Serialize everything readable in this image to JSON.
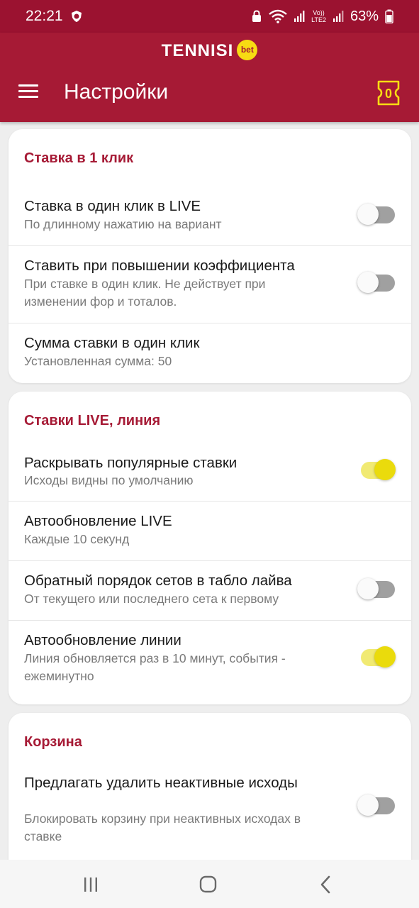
{
  "status_bar": {
    "time": "22:21",
    "lte_top": "Vo))",
    "lte_bottom": "LTE2",
    "battery": "63%"
  },
  "app_bar": {
    "logo": "TENNISI",
    "logo_badge": "bet",
    "title": "Настройки",
    "coupon_count": "0"
  },
  "colors": {
    "brand": "#a61a35",
    "status": "#9b1230",
    "toggle_on": "#eadb0c",
    "toggle_off": "#a0a0a0"
  },
  "sections": [
    {
      "header": "Ставка в 1 клик",
      "items": [
        {
          "title": "Ставка в один клик в LIVE",
          "subtitle": "По длинному нажатию на вариант",
          "toggle": false
        },
        {
          "title": "Ставить при повышении коэффициента",
          "subtitle": "При ставке в один клик. Не действует при изменении фор и тоталов.",
          "toggle": false
        },
        {
          "title": "Сумма ставки в один клик",
          "subtitle": "Установленная сумма: 50"
        }
      ]
    },
    {
      "header": "Ставки LIVE, линия",
      "items": [
        {
          "title": "Раскрывать популярные ставки",
          "subtitle": "Исходы видны по умолчанию",
          "toggle": true
        },
        {
          "title": "Автообновление LIVE",
          "subtitle": "Каждые 10 секунд"
        },
        {
          "title": "Обратный порядок сетов в табло лайва",
          "subtitle": "От текущего или последнего сета к первому",
          "toggle": false
        },
        {
          "title": "Автообновление линии",
          "subtitle": "Линия обновляется раз в 10 минут, события - ежеминутно",
          "toggle": true
        }
      ]
    },
    {
      "header": "Корзина",
      "items": [
        {
          "title": "Предлагать удалить неактивные исходы",
          "subtitle": "Блокировать корзину при неактивных исходах в ставке",
          "toggle": false
        }
      ]
    }
  ],
  "nav": {
    "recents": "recents-icon",
    "home": "home-icon",
    "back": "back-icon"
  }
}
